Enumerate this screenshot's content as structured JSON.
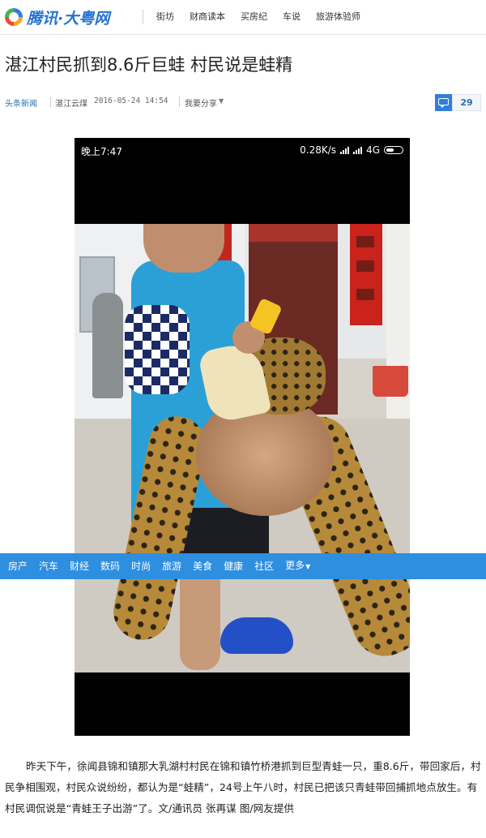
{
  "header": {
    "logo_text": "腾讯·大粤网",
    "nav": [
      "街坊",
      "财商读本",
      "买房纪",
      "车说",
      "旅游体验师"
    ]
  },
  "article": {
    "title": "湛江村民抓到8.6斤巨蛙 村民说是蛙精",
    "source": "头条新闻",
    "author": "湛江云煤",
    "time": "2016-05-24 14:54",
    "share_label": "我要分享",
    "comment_count": "29",
    "body": "昨天下午，徐闻县锦和镇那大乳湖村村民在锦和镇竹桥港抓到巨型青蛙一只，重8.6斤，带回家后，村民争相围观，村民众说纷纷，都认为是“蛙精”，24号上午八时，村民已把该只青蛙带回捕抓地点放生。有村民调侃说是“青蛙王子出游”了。文/通讯员 张再谋 图/网友提供"
  },
  "phone_status": {
    "time": "晚上7:47",
    "net_speed": "0.28K/s",
    "network": "4G"
  },
  "category_bar": {
    "items": [
      "房产",
      "汽车",
      "财经",
      "数码",
      "时尚",
      "旅游",
      "美食",
      "健康",
      "社区"
    ],
    "more_label": "更多"
  },
  "colors": {
    "brand_blue": "#2572d2",
    "category_bar": "#2e8ee0",
    "link_blue": "#2a6fb0"
  },
  "icons": [
    "tencent-logo-icon",
    "comment-icon",
    "signal-icon",
    "battery-icon",
    "caret-down-icon"
  ]
}
